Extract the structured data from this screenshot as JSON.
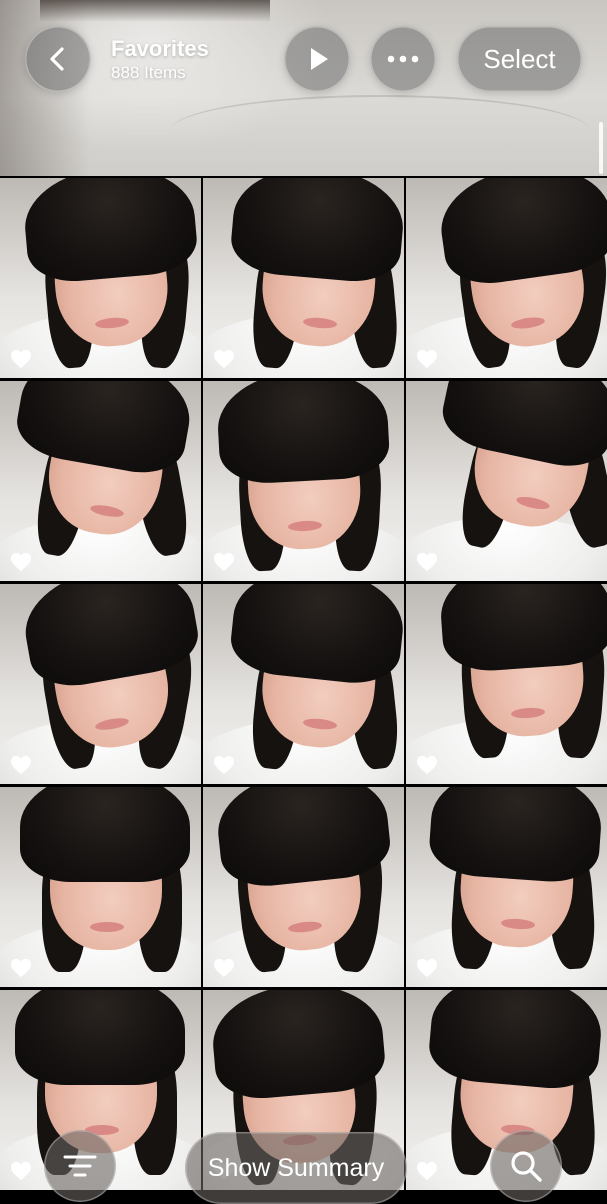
{
  "header": {
    "title": "Favorites",
    "subtitle": "888 Items",
    "select_label": "Select",
    "icons": {
      "back": "chevron-left-icon",
      "play": "play-icon",
      "more": "ellipsis-icon"
    }
  },
  "grid": {
    "columns": 3,
    "photos": [
      {
        "favorite": true
      },
      {
        "favorite": true
      },
      {
        "favorite": true
      },
      {
        "favorite": true
      },
      {
        "favorite": true
      },
      {
        "favorite": true
      },
      {
        "favorite": true
      },
      {
        "favorite": true
      },
      {
        "favorite": true
      },
      {
        "favorite": true
      },
      {
        "favorite": true
      },
      {
        "favorite": true
      },
      {
        "favorite": true
      },
      {
        "favorite": true
      },
      {
        "favorite": true
      }
    ]
  },
  "bottom_bar": {
    "summary_label": "Show Summary",
    "icons": {
      "filter": "filter-lines-icon",
      "search": "magnifier-icon"
    }
  }
}
